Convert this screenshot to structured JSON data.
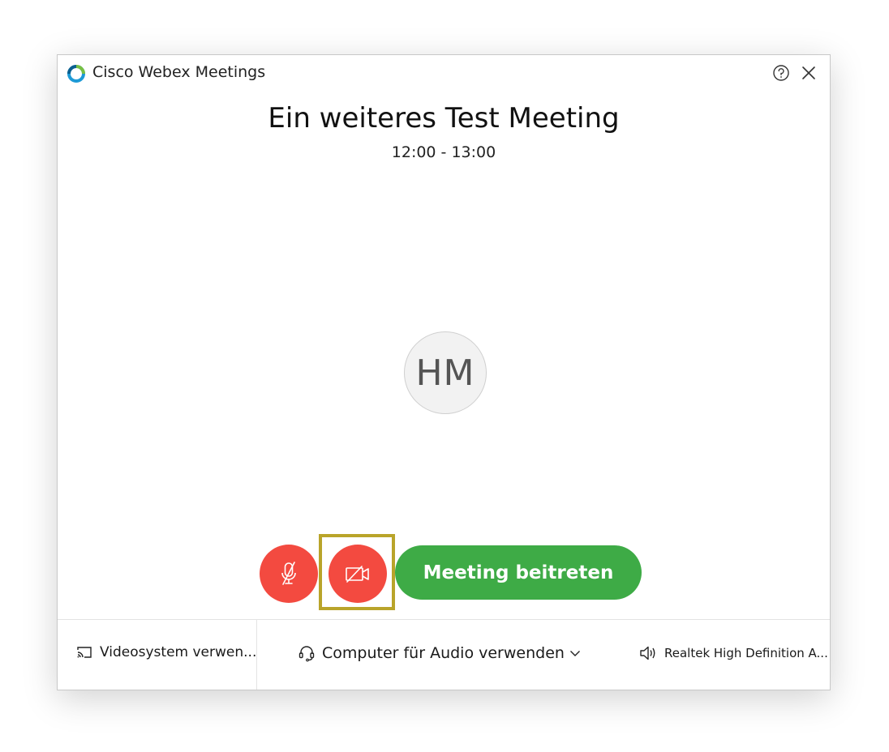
{
  "app": {
    "title": "Cisco Webex Meetings"
  },
  "meeting": {
    "title": "Ein weiteres Test Meeting",
    "time": "12:00 - 13:00",
    "avatar_initials": "HM"
  },
  "controls": {
    "join_label": "Meeting beitreten",
    "mute_icon": "microphone-muted-icon",
    "video_icon": "video-off-icon"
  },
  "bottom_bar": {
    "video_system_label": "Videosystem verwen...",
    "audio_label": "Computer für Audio verwenden",
    "speaker_label": "Realtek High Definition A..."
  },
  "colors": {
    "mute_red": "#f34a40",
    "join_green": "#3eab46",
    "highlight": "#b9a42a"
  }
}
